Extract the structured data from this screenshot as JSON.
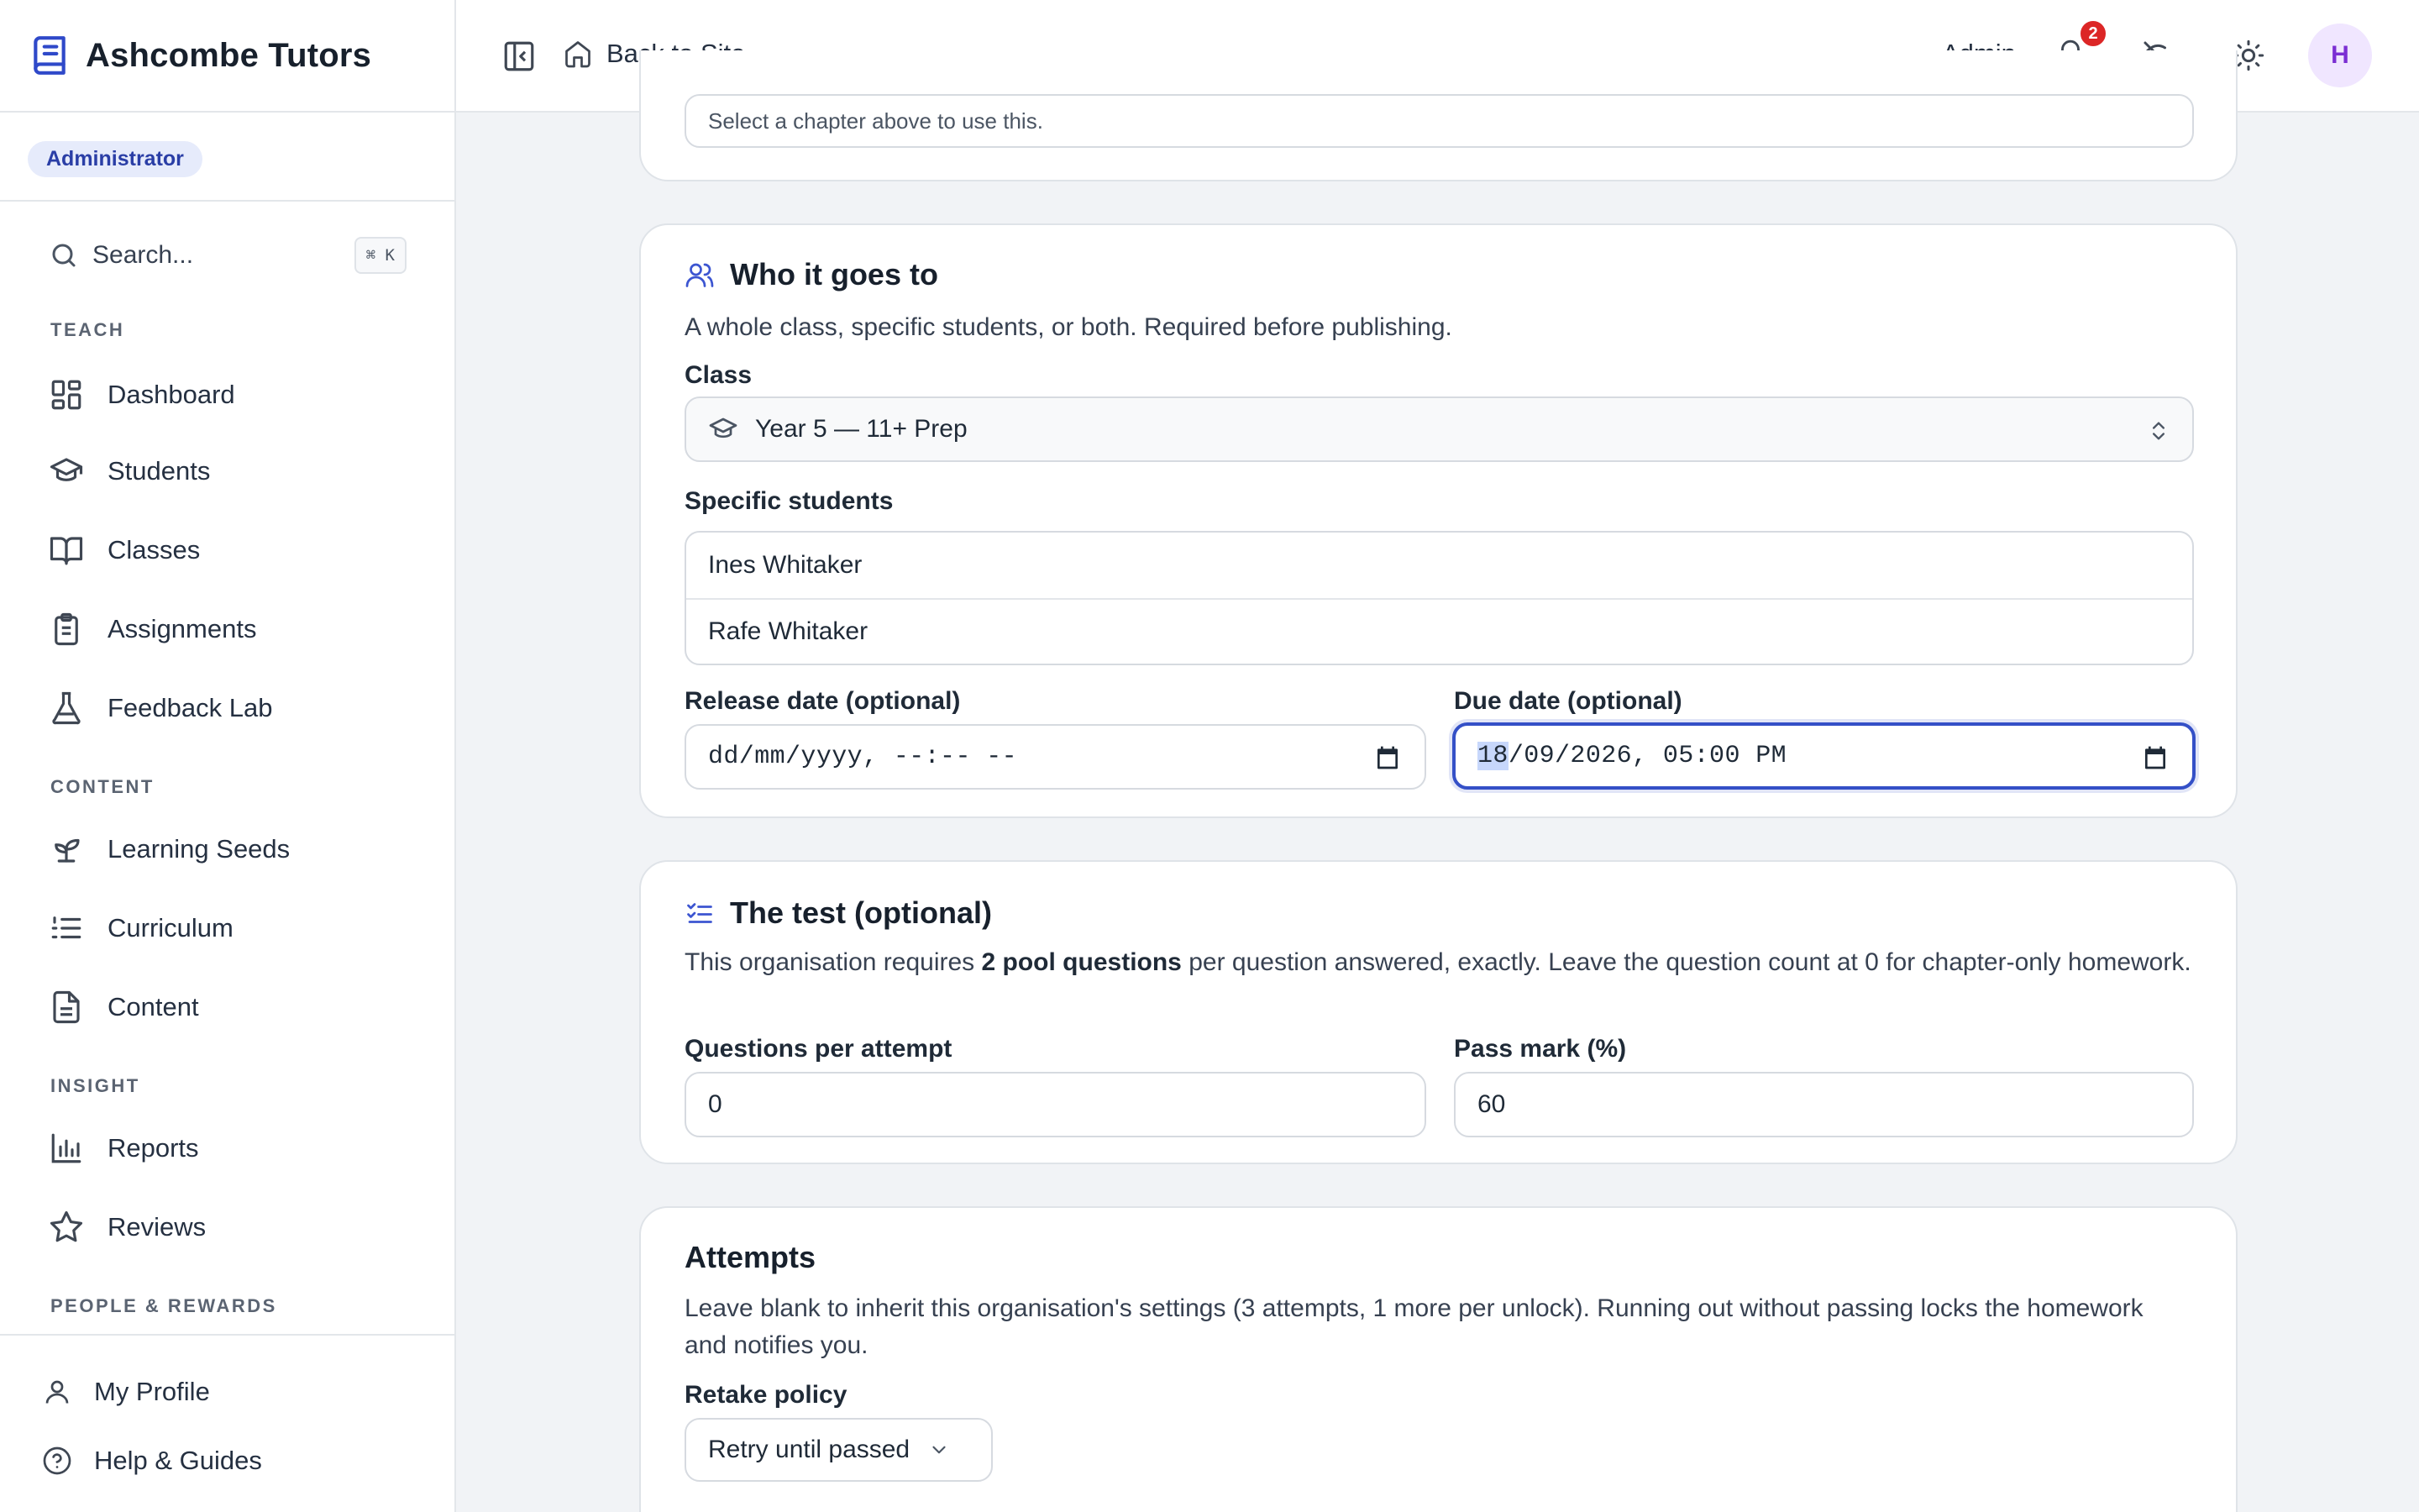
{
  "app": {
    "name": "Ashcombe Tutors",
    "role": "Administrator"
  },
  "search": {
    "placeholder": "Search...",
    "shortcut": "⌘ K"
  },
  "sidebar": {
    "sections": {
      "teach": "TEACH",
      "content": "CONTENT",
      "insight": "INSIGHT",
      "people": "PEOPLE & REWARDS"
    },
    "items": {
      "dashboard": "Dashboard",
      "students": "Students",
      "classes": "Classes",
      "assignments": "Assignments",
      "feedback_lab": "Feedback Lab",
      "learning_seeds": "Learning Seeds",
      "curriculum": "Curriculum",
      "content": "Content",
      "reports": "Reports",
      "reviews": "Reviews"
    },
    "footer": {
      "profile": "My Profile",
      "help": "Help & Guides"
    }
  },
  "topbar": {
    "back_label": "Back to Site",
    "user_label": "Admin",
    "notification_count": "2",
    "avatar_initial": "H"
  },
  "chapter_card": {
    "hint": "Select a chapter above to use this."
  },
  "audience_card": {
    "title": "Who it goes to",
    "description": "A whole class, specific students, or both. Required before publishing.",
    "class_label": "Class",
    "class_value": "Year 5 — 11+ Prep",
    "students_label": "Specific students",
    "students": [
      "Ines Whitaker",
      "Rafe Whitaker"
    ],
    "release_label": "Release date (optional)",
    "release_placeholder": "dd/mm/yyyy, --:-- --",
    "due_label": "Due date (optional)",
    "due_day": "18",
    "due_rest": "/09/2026, 05:00 PM"
  },
  "test_card": {
    "title": "The test (optional)",
    "desc_before": "This organisation requires ",
    "desc_bold": "2 pool questions",
    "desc_after": " per question answered, exactly. Leave the question count at 0 for chapter-only homework.",
    "questions_label": "Questions per attempt",
    "questions_value": "0",
    "pass_label": "Pass mark (%)",
    "pass_value": "60"
  },
  "attempts_card": {
    "title": "Attempts",
    "description": "Leave blank to inherit this organisation's settings (3 attempts, 1 more per unlock). Running out without passing locks the homework and notifies you.",
    "retake_label": "Retake policy",
    "retake_value": "Retry until passed"
  },
  "colors": {
    "accent": "#3450c7",
    "badge_red": "#dc2626",
    "avatar_bg": "#f0e6ff"
  }
}
